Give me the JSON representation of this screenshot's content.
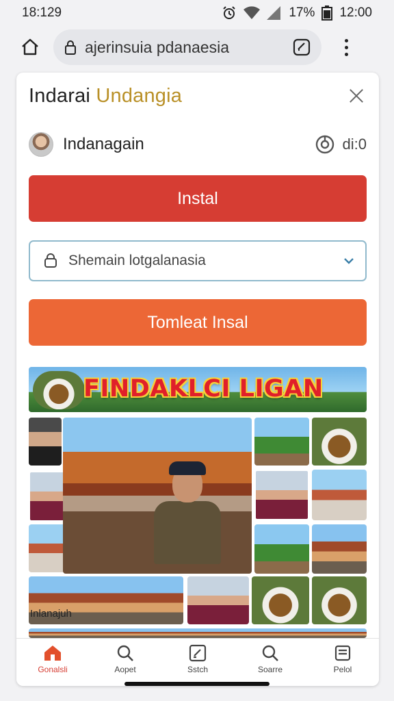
{
  "status_bar": {
    "time": "18:129",
    "battery": "17%",
    "clock": "12:00"
  },
  "browser": {
    "url": "ajerinsuia pdanaesia"
  },
  "card": {
    "title_part1": "Indarai",
    "title_part2": "Undangia",
    "account_name": "Indanagain",
    "account_meta": "di:0",
    "install_label": "Instal",
    "search_value": "Shemain lotgalanasia",
    "secondary_label": "Tomleat Insal",
    "banner_text": "FINDAKLCI LIGAN",
    "accent_color": "#b99027",
    "install_color": "#d63d33",
    "secondary_color": "#ec6736"
  },
  "bottom_nav": {
    "items": [
      {
        "label": "Gonalsli",
        "icon": "home-icon"
      },
      {
        "label": "Aopet",
        "icon": "search-icon"
      },
      {
        "label": "Sstch",
        "icon": "edit-square-icon"
      },
      {
        "label": "Soarre",
        "icon": "search-icon"
      },
      {
        "label": "Pelol",
        "icon": "profile-card-icon"
      }
    ]
  },
  "footer": {
    "text": "Inlanajuh"
  }
}
